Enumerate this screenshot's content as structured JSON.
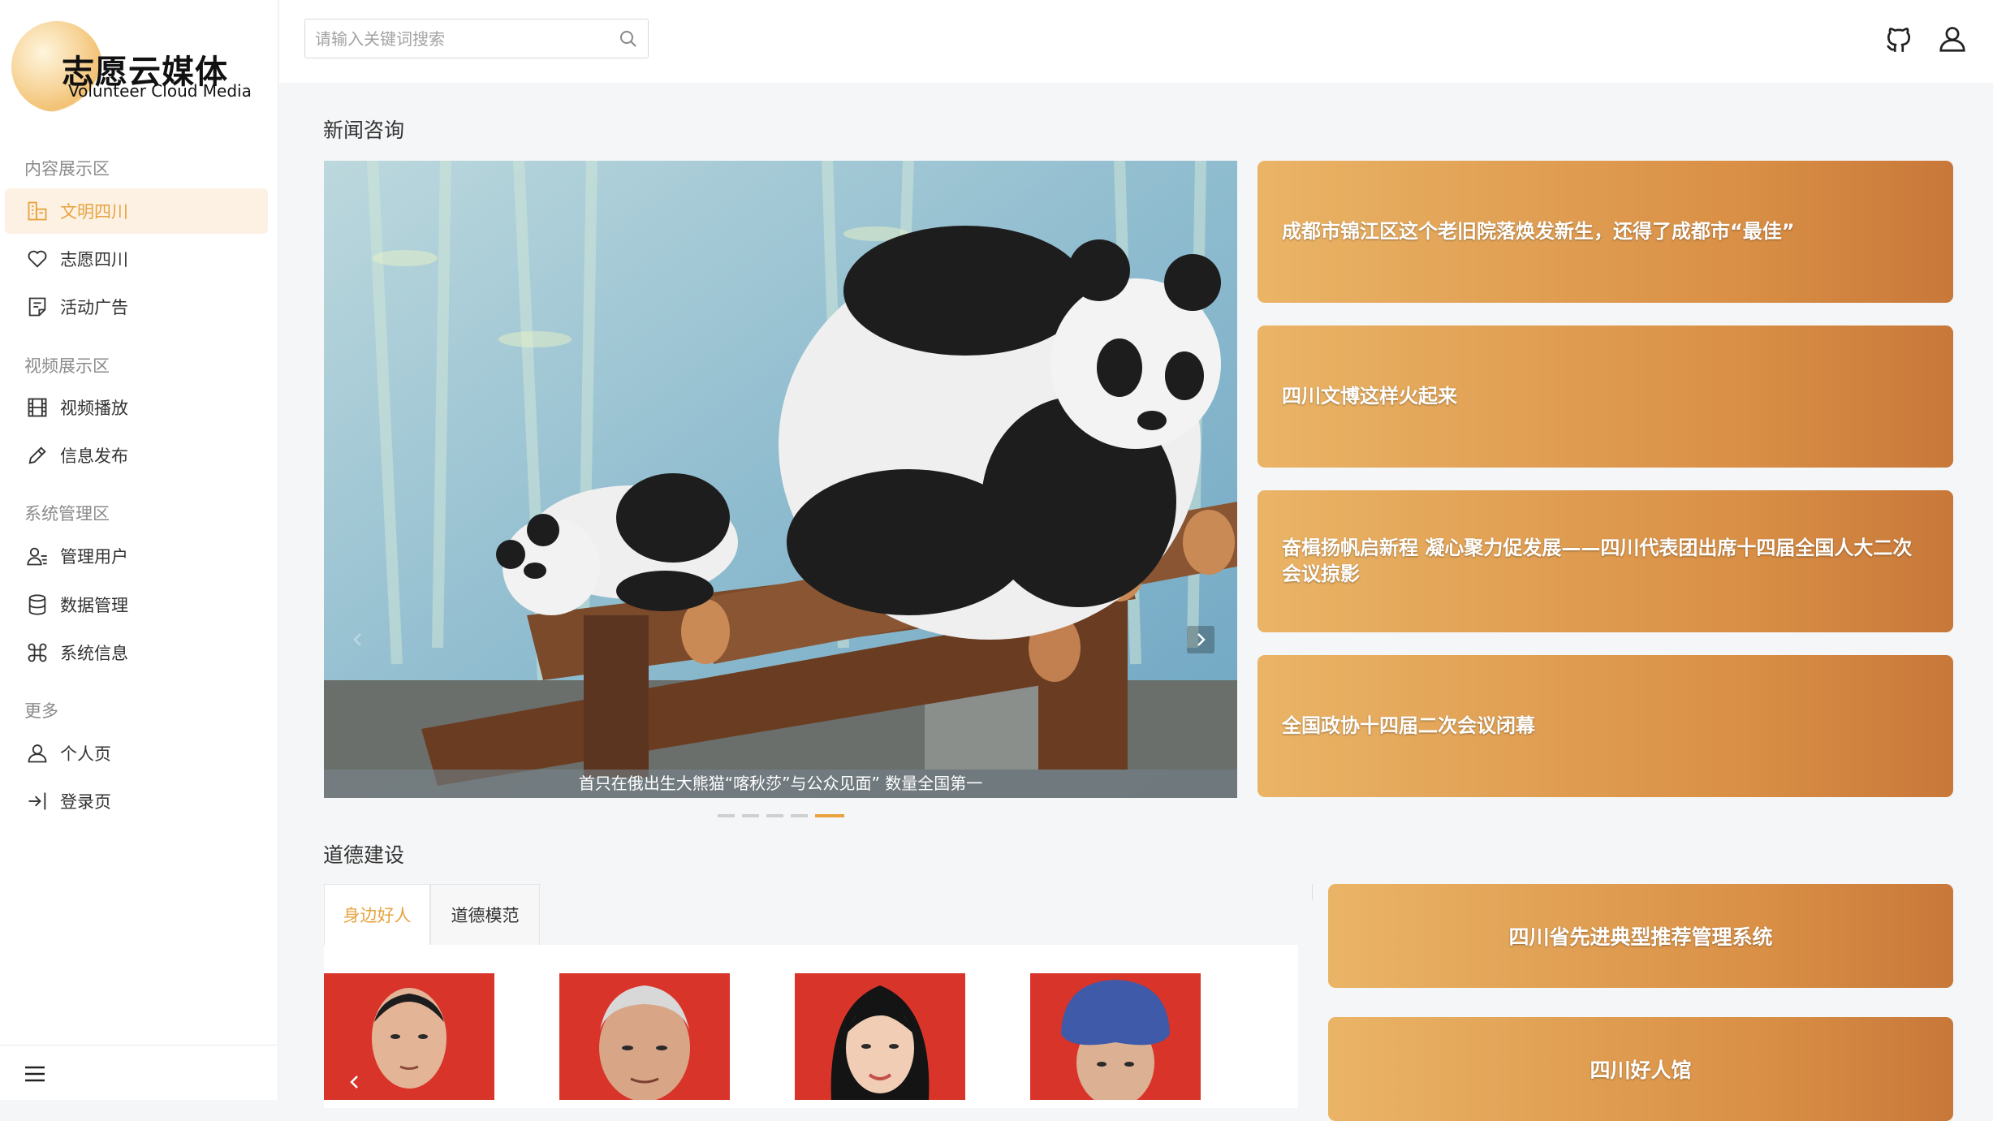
{
  "brand": {
    "name_cn": "志愿云媒体",
    "name_en": "Volunteer Cloud Media"
  },
  "sidebar": {
    "sections": [
      {
        "title": "内容展示区",
        "items": [
          {
            "label": "文明四川",
            "icon": "building-icon",
            "active": true
          },
          {
            "label": "志愿四川",
            "icon": "heart-icon",
            "active": false
          },
          {
            "label": "活动广告",
            "icon": "notepad-icon",
            "active": false
          }
        ]
      },
      {
        "title": "视频展示区",
        "items": [
          {
            "label": "视频播放",
            "icon": "film-icon",
            "active": false
          },
          {
            "label": "信息发布",
            "icon": "pencil-icon",
            "active": false
          }
        ]
      },
      {
        "title": "系统管理区",
        "items": [
          {
            "label": "管理用户",
            "icon": "user-list-icon",
            "active": false
          },
          {
            "label": "数据管理",
            "icon": "database-icon",
            "active": false
          },
          {
            "label": "系统信息",
            "icon": "command-icon",
            "active": false
          }
        ]
      },
      {
        "title": "更多",
        "items": [
          {
            "label": "个人页",
            "icon": "user-icon",
            "active": false
          },
          {
            "label": "登录页",
            "icon": "login-icon",
            "active": false
          }
        ]
      }
    ]
  },
  "header": {
    "search_placeholder": "请输入关键词搜索"
  },
  "news": {
    "title": "新闻咨询",
    "carousel_caption": "首只在俄出生大熊猫“喀秋莎”与公众见面” 数量全国第一",
    "slide_count": 5,
    "active_slide": 5,
    "cards": [
      "成都市锦江区这个老旧院落焕发新生，还得了成都市“最佳”",
      "四川文博这样火起来",
      "奋楫扬帆启新程 凝心聚力促发展——四川代表团出席十四届全国人大二次会议掠影",
      "全国政协十四届二次会议闭幕"
    ]
  },
  "morality": {
    "title": "道德建设",
    "tabs": [
      "身边好人",
      "道德模范"
    ],
    "active_tab": 0,
    "links": [
      "四川省先进典型推荐管理系统",
      "四川好人馆"
    ]
  },
  "colors": {
    "accent": "#e8a33e",
    "card_start": "#eab466",
    "card_end": "#c8783a",
    "portrait_bg": "#d9342a"
  }
}
